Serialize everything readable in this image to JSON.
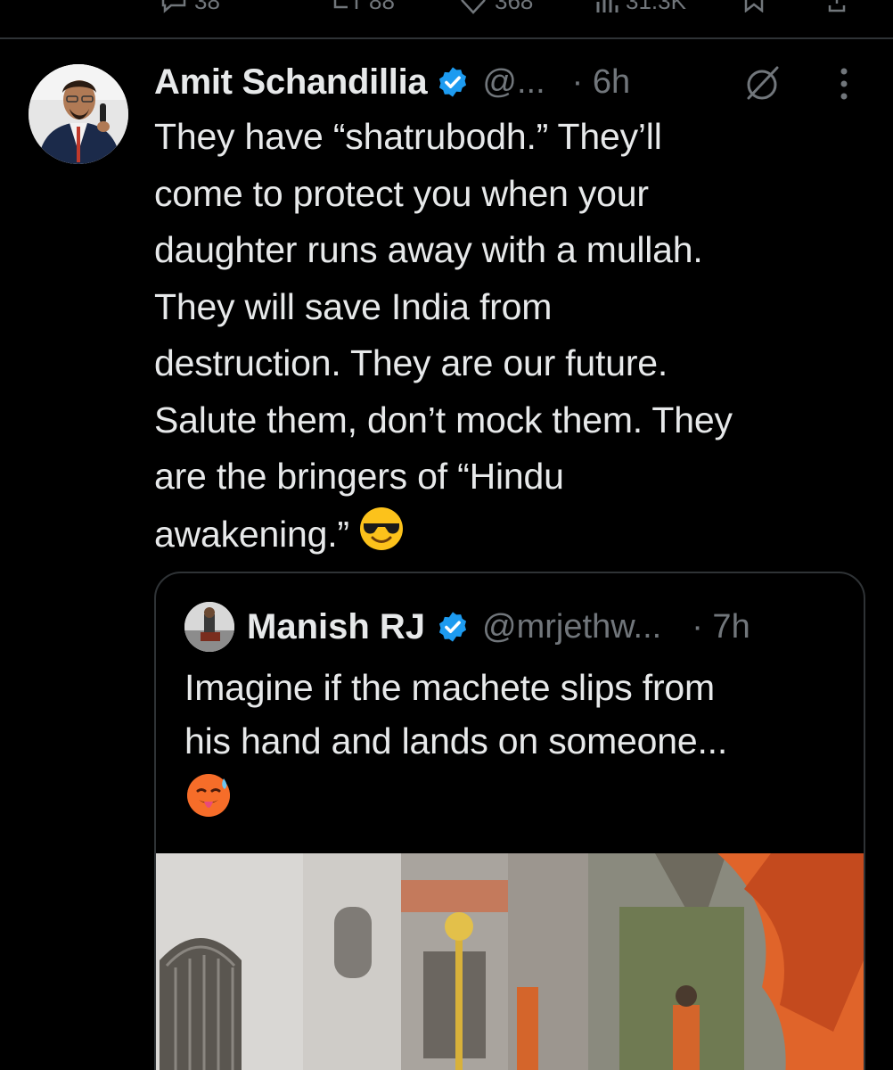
{
  "top_actions": {
    "replies": "38",
    "reposts": "88",
    "likes": "368",
    "views": "31.3K"
  },
  "tweet": {
    "author_name": "Amit Schandillia",
    "handle": "@...",
    "time": "· 6h",
    "text": "They have “shatrubodh.” They’ll\ncome to protect you when your\ndaughter runs away with a mullah.\nThey will save India from\ndestruction. They are our future.\nSalute them, don’t mock them. They\nare the bringers of “Hindu\nawakening.”",
    "emoji": "smiling-face-with-sunglasses",
    "icons": [
      "verified-badge-icon",
      "edited-icon",
      "more-icon"
    ]
  },
  "quoted_tweet": {
    "author_name": "Manish RJ",
    "handle": "@mrjethw...",
    "time": "· 7h",
    "text": "Imagine if the machete slips from\nhis hand and lands on someone...",
    "emoji": "hot-face",
    "media": "street-scene-with-saffron-flags"
  },
  "colors": {
    "background": "#000000",
    "text": "#e7e9ea",
    "secondary": "#71767b",
    "border": "#2f3336",
    "verified": "#1d9bf0"
  }
}
